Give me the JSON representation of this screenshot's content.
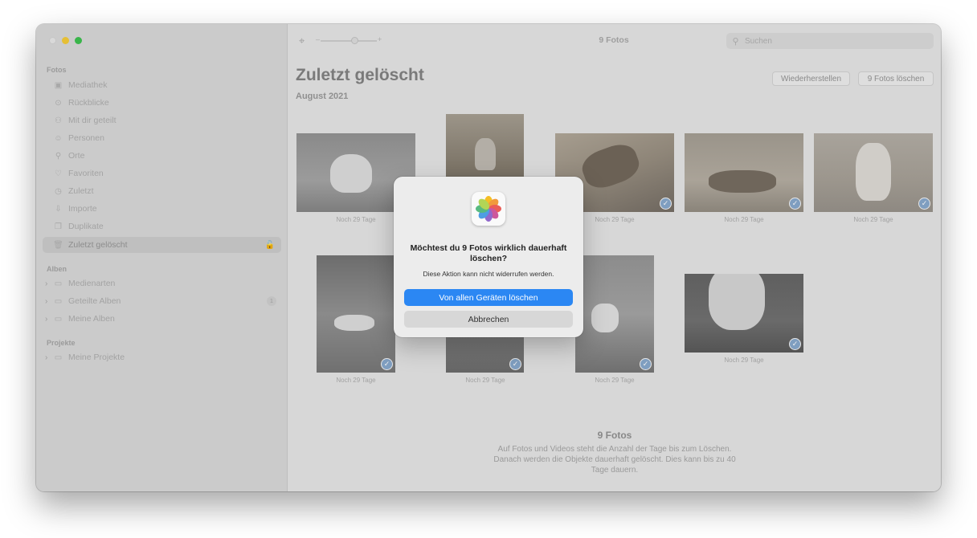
{
  "window": {
    "title": "9 Fotos",
    "search_placeholder": "Suchen"
  },
  "sidebar": {
    "sections": {
      "fotos": "Fotos",
      "alben": "Alben",
      "projekte": "Projekte"
    },
    "library_items": [
      {
        "label": "Mediathek",
        "icon": "library-icon"
      },
      {
        "label": "Rückblicke",
        "icon": "memories-icon"
      },
      {
        "label": "Mit dir geteilt",
        "icon": "shared-with-you-icon"
      },
      {
        "label": "Personen",
        "icon": "people-icon"
      },
      {
        "label": "Orte",
        "icon": "places-icon"
      },
      {
        "label": "Favoriten",
        "icon": "heart-icon"
      },
      {
        "label": "Zuletzt",
        "icon": "clock-icon"
      },
      {
        "label": "Importe",
        "icon": "import-icon"
      },
      {
        "label": "Duplikate",
        "icon": "duplicates-icon"
      },
      {
        "label": "Zuletzt gelöscht",
        "icon": "trash-icon",
        "selected": true
      }
    ],
    "album_items": [
      {
        "label": "Medienarten",
        "icon": "folder-icon"
      },
      {
        "label": "Geteilte Alben",
        "icon": "folder-icon",
        "count": "1"
      },
      {
        "label": "Meine Alben",
        "icon": "folder-icon"
      }
    ],
    "project_items": [
      {
        "label": "Meine Projekte",
        "icon": "folder-icon"
      }
    ]
  },
  "main": {
    "title": "Zuletzt gelöscht",
    "subtitle": "August 2021",
    "restore_button": "Wiederherstellen",
    "delete_button": "9 Fotos löschen",
    "photo_caption": "Noch 29 Tage",
    "footer_title": "9 Fotos",
    "footer_text": "Auf Fotos und Videos steht die Anzahl der Tage bis zum Löschen. Danach werden die Objekte dauerhaft gelöscht. Dies kann bis zu 40 Tage dauern."
  },
  "dialog": {
    "title": "Möchtest du 9 Fotos wirklich dauerhaft löschen?",
    "message": "Diese Aktion kann nicht widerrufen werden.",
    "confirm_button": "Von allen Geräten löschen",
    "cancel_button": "Abbrechen"
  },
  "colors": {
    "accent": "#2b87f3",
    "check": "#7f9ec0"
  }
}
